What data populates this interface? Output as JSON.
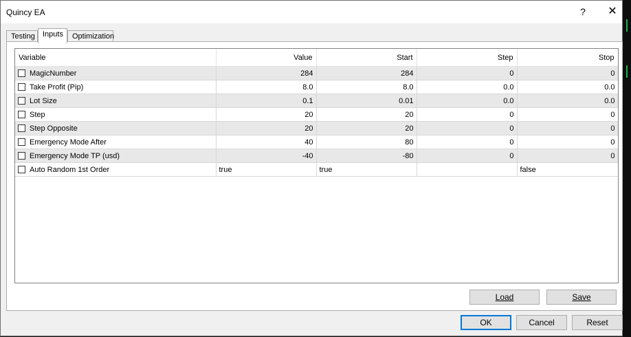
{
  "window": {
    "title": "Quincy EA",
    "help_label": "?",
    "close_label": "✕"
  },
  "tabs": [
    {
      "label": "Testing"
    },
    {
      "label": "Inputs"
    },
    {
      "label": "Optimization"
    }
  ],
  "active_tab": "Inputs",
  "table": {
    "headers": [
      "Variable",
      "Value",
      "Start",
      "Step",
      "Stop"
    ],
    "rows": [
      {
        "variable": "MagicNumber",
        "value": "284",
        "start": "284",
        "step": "0",
        "stop": "0",
        "checked": false
      },
      {
        "variable": "Take Profit (Pip)",
        "value": "8.0",
        "start": "8.0",
        "step": "0.0",
        "stop": "0.0",
        "checked": false
      },
      {
        "variable": "Lot Size",
        "value": "0.1",
        "start": "0.01",
        "step": "0.0",
        "stop": "0.0",
        "checked": false
      },
      {
        "variable": "Step",
        "value": "20",
        "start": "20",
        "step": "0",
        "stop": "0",
        "checked": false
      },
      {
        "variable": "Step Opposite",
        "value": "20",
        "start": "20",
        "step": "0",
        "stop": "0",
        "checked": false
      },
      {
        "variable": "Emergency Mode After",
        "value": "40",
        "start": "80",
        "step": "0",
        "stop": "0",
        "checked": false
      },
      {
        "variable": "Emergency Mode TP (usd)",
        "value": "-40",
        "start": "-80",
        "step": "0",
        "stop": "0",
        "checked": false
      },
      {
        "variable": "Auto Random 1st Order",
        "value": "true",
        "start": "true",
        "step": "",
        "stop": "false",
        "checked": false
      }
    ]
  },
  "buttons": {
    "load": "Load",
    "save": "Save",
    "ok": "OK",
    "cancel": "Cancel",
    "reset": "Reset"
  }
}
